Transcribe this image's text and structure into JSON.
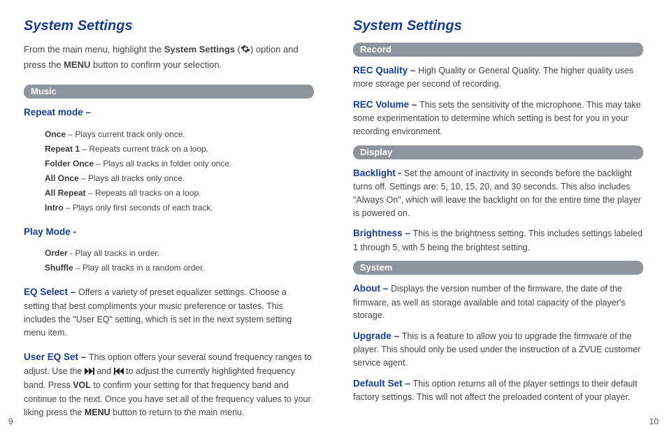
{
  "left": {
    "title": "System Settings",
    "intro_a": "From the main menu, highlight the ",
    "intro_b": "System Settings",
    "intro_c": " option and press the ",
    "intro_d": "MENU",
    "intro_e": " button to confirm your selection.",
    "music_bar": "Music",
    "repeat_label": "Repeat mode –",
    "repeat": {
      "once_l": "Once",
      "once_d": " – Plays current track only once.",
      "rep1_l": "Repeat 1",
      "rep1_d": " – Repeats current track on a loop.",
      "fold_l": "Folder Once",
      "fold_d": " – Plays all tracks in folder only once.",
      "allo_l": "All Once",
      "allo_d": " – Plays all tracks only once.",
      "allr_l": "All Repeat",
      "allr_d": " – Repeats all tracks on a loop.",
      "intro_l": "Intro",
      "intro_d": " – Plays only first seconds of each track."
    },
    "play_label": "Play Mode -",
    "play": {
      "order_l": "Order",
      "order_d": " - Play all tracks in order.",
      "shuf_l": "Shuffle",
      "shuf_d": " – Play all tracks in a random order."
    },
    "eq_label": "EQ Select – ",
    "eq_text": "Offers a variety of preset equalizer settings. Choose a setting that best compliments your music preference or tastes. This includes the \"User EQ\" setting, which is set in the next system setting menu item.",
    "usereq_label": "User EQ Set – ",
    "usereq_a": "This option offers your several sound frequency ranges to adjust. Use the ",
    "usereq_b": " and ",
    "usereq_c": " to adjust the currently highlighted frequency band. Press ",
    "usereq_vol": "VOL",
    "usereq_d": " to confirm your setting for that frequency band and continue to the next. Once you have set all of the frequency values to your liking press the ",
    "usereq_menu": "MENU",
    "usereq_e": " button to return to the main menu.",
    "pagenum": "9"
  },
  "right": {
    "title": "System Settings",
    "record_bar": "Record",
    "recq_label": "REC Quality – ",
    "recq_text": "High Quality or General Quality. The higher quality uses more storage per second of recording.",
    "recv_label": "REC Volume – ",
    "recv_text": "This sets the sensitivity of the microphone. This may take some experimentation to determine which setting is best for you in your recording environment.",
    "display_bar": "Display",
    "back_label": "Backlight - ",
    "back_text": "Set the amount of inactivity in seconds before the backlight turns off. Settings are: 5, 10, 15, 20, and 30 seconds. This also includes \"Always On\", which will leave the backlight on for the entire time the player is powered on.",
    "bright_label": "Brightness – ",
    "bright_text": "This is the brightness setting. This includes settings labeled 1 through 5, with 5 being the brightest setting.",
    "system_bar": "System",
    "about_label": "About – ",
    "about_text": "Displays the version number of the firmware, the date of the firmware, as well as storage available and total capacity of the player's storage.",
    "upgrade_label": "Upgrade – ",
    "upgrade_text": "This is a feature to allow you to upgrade the firmware of the player. This should only be used under the instruction of a ZVUE customer service agent.",
    "default_label": "Default Set – ",
    "default_text": "This option returns all of the player settings to their default factory settings. This will not affect the preloaded content of your player.",
    "pagenum": "10"
  }
}
